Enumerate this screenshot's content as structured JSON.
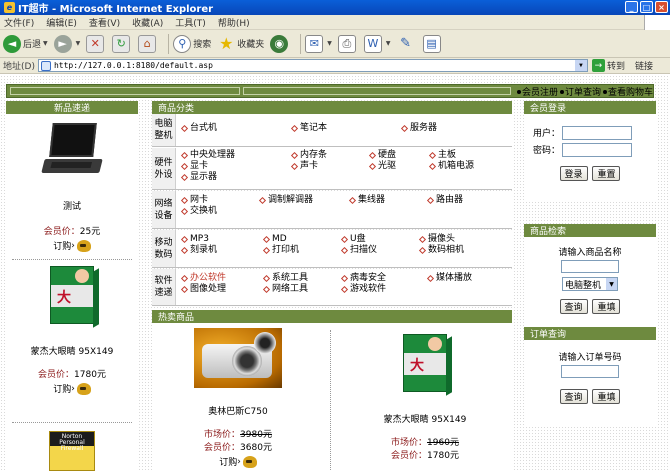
{
  "window": {
    "title": "IT超市 - Microsoft Internet Explorer",
    "logo": "e"
  },
  "menu": [
    "文件(F)",
    "编辑(E)",
    "查看(V)",
    "收藏(A)",
    "工具(T)",
    "帮助(H)"
  ],
  "toolbar": {
    "back": "后退",
    "search": "搜索",
    "favorites": "收藏夹"
  },
  "address": {
    "label": "地址(D)",
    "url": "http://127.0.0.1:8180/default.asp",
    "go": "转到",
    "links": "链接"
  },
  "topnav": [
    "会员注册",
    "订单查询",
    "查看购物车"
  ],
  "left": {
    "header": "新品速递",
    "products": [
      {
        "name": "测试",
        "price_label": "会员价：",
        "price": "25元",
        "order": "订购"
      },
      {
        "name": "蒙杰大眼睛 95X149",
        "price_label": "会员价：",
        "price": "1780元",
        "order": "订购"
      }
    ],
    "norton_box": [
      "Norton",
      "Personal Firewall"
    ]
  },
  "categories": {
    "header": "商品分类",
    "rows": [
      {
        "label": "电脑整机",
        "items": [
          "台式机",
          "笔记本",
          "服务器"
        ]
      },
      {
        "label": "硬件外设",
        "items": [
          "中央处理器",
          "内存条",
          "硬盘",
          "主板",
          "显卡",
          "声卡",
          "光驱",
          "机箱电源",
          "显示器"
        ]
      },
      {
        "label": "网络设备",
        "items": [
          "网卡",
          "调制解调器",
          "集线器",
          "路由器",
          "交换机"
        ]
      },
      {
        "label": "移动数码",
        "items": [
          "MP3",
          "MD",
          "U盘",
          "摄像头",
          "刻录机",
          "打印机",
          "扫描仪",
          "数码相机"
        ]
      },
      {
        "label": "软件速递",
        "items": [
          "办公软件",
          "系统工具",
          "病毒安全",
          "媒体播放",
          "图像处理",
          "网络工具",
          "游戏软件"
        ]
      }
    ]
  },
  "hot": {
    "header": "热卖商品",
    "products": [
      {
        "name": "奥林巴斯C750",
        "market_label": "市场价：",
        "market": "3980元",
        "member_label": "会员价：",
        "member": "3680元",
        "order": "订购"
      },
      {
        "name": "蒙杰大眼睛 95X149",
        "market_label": "市场价：",
        "market": "1960元",
        "member_label": "会员价：",
        "member": "1780元"
      }
    ]
  },
  "login": {
    "header": "会员登录",
    "user_label": "用户：",
    "pass_label": "密码：",
    "login_btn": "登录",
    "reset_btn": "重置"
  },
  "search": {
    "header": "商品检索",
    "prompt": "请输入商品名称",
    "select_value": "电脑整机",
    "query_btn": "查询",
    "reset_btn": "重填"
  },
  "orderq": {
    "header": "订单查询",
    "prompt": "请输入订单号码",
    "query_btn": "查询",
    "reset_btn": "重填"
  },
  "colors": {
    "green": "#6e8a3f",
    "red": "#c0392b",
    "price": "#8b1a1a"
  },
  "icons": [
    "ie-logo-icon",
    "back-icon",
    "forward-icon",
    "stop-icon",
    "refresh-icon",
    "home-icon",
    "search-icon",
    "favorites-icon",
    "media-icon",
    "mail-icon",
    "print-icon",
    "edit-icon",
    "messenger-icon",
    "go-icon",
    "order-icon"
  ]
}
